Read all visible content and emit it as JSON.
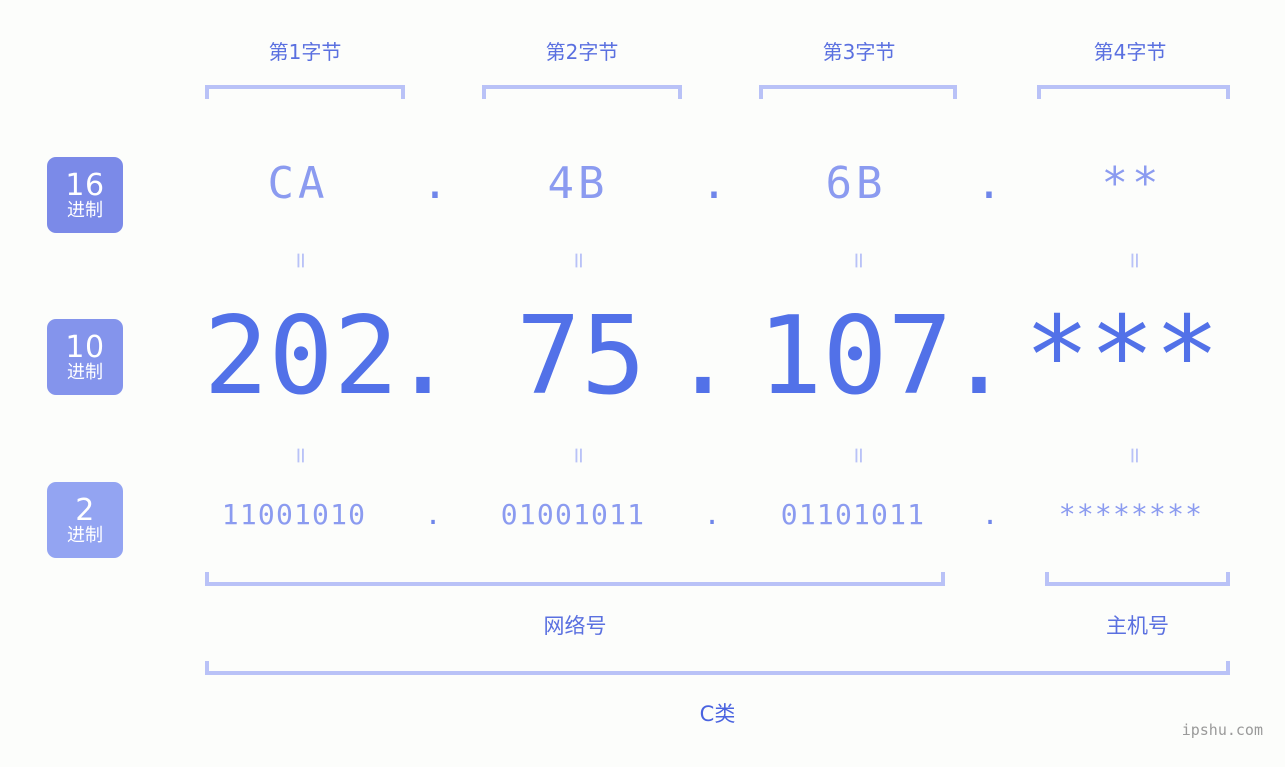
{
  "page": {
    "background_color": "#fcfdfb",
    "accent_color": "#5271e8",
    "muted_accent_color": "#8b9bf0",
    "bracket_color": "#b9c2f7",
    "watermark": "ipshu.com"
  },
  "byte_headers": [
    {
      "label": "第1字节"
    },
    {
      "label": "第2字节"
    },
    {
      "label": "第3字节"
    },
    {
      "label": "第4字节"
    }
  ],
  "bases": [
    {
      "number": "16",
      "system": "进制",
      "color": "#7b8ae8"
    },
    {
      "number": "10",
      "system": "进制",
      "color": "#8494ec"
    },
    {
      "number": "2",
      "system": "进制",
      "color": "#93a4f2"
    }
  ],
  "rows": {
    "hex": {
      "values": [
        "CA",
        "4B",
        "6B",
        "**"
      ],
      "separator": "."
    },
    "decimal": {
      "values": [
        "202",
        "75",
        "107",
        "***"
      ],
      "separator": "."
    },
    "binary": {
      "values": [
        "11001010",
        "01001011",
        "01101011",
        "********"
      ],
      "separator": "."
    }
  },
  "equals_separator": "=",
  "parts": [
    {
      "label": "网络号"
    },
    {
      "label": "主机号"
    }
  ],
  "address_class": {
    "label": "C类"
  }
}
